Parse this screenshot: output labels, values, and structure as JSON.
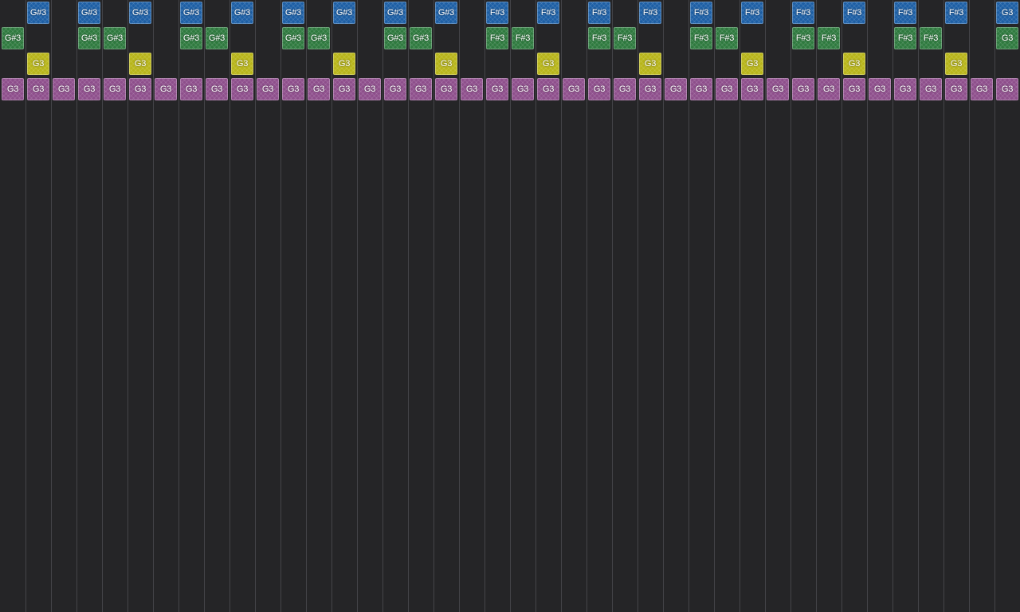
{
  "colors": {
    "background": "#252527",
    "grid_line": "#444448",
    "lanes": [
      "#1d5fa5",
      "#2f7a3f",
      "#b8b51a",
      "#8e4f8c"
    ]
  },
  "columns": 40,
  "lanes": [
    {
      "name": "lane-1",
      "notes": [
        "",
        "G#3",
        "",
        "G#3",
        "",
        "G#3",
        "",
        "G#3",
        "",
        "G#3",
        "",
        "G#3",
        "",
        "G#3",
        "",
        "G#3",
        "",
        "G#3",
        "",
        "F#3",
        "",
        "F#3",
        "",
        "F#3",
        "",
        "F#3",
        "",
        "F#3",
        "",
        "F#3",
        "",
        "F#3",
        "",
        "F#3",
        "",
        "F#3",
        "",
        "F#3",
        "",
        "G3"
      ]
    },
    {
      "name": "lane-2",
      "notes": [
        "G#3",
        "",
        "",
        "G#3",
        "G#3",
        "",
        "",
        "G#3",
        "G#3",
        "",
        "",
        "G#3",
        "G#3",
        "",
        "",
        "G#3",
        "G#3",
        "",
        "",
        "F#3",
        "F#3",
        "",
        "",
        "F#3",
        "F#3",
        "",
        "",
        "F#3",
        "F#3",
        "",
        "",
        "F#3",
        "F#3",
        "",
        "",
        "F#3",
        "F#3",
        "",
        "",
        "G3"
      ]
    },
    {
      "name": "lane-3",
      "notes": [
        "",
        "G3",
        "",
        "",
        "",
        "G3",
        "",
        "",
        "",
        "G3",
        "",
        "",
        "",
        "G3",
        "",
        "",
        "",
        "G3",
        "",
        "",
        "",
        "G3",
        "",
        "",
        "",
        "G3",
        "",
        "",
        "",
        "G3",
        "",
        "",
        "",
        "G3",
        "",
        "",
        "",
        "G3",
        "",
        ""
      ]
    },
    {
      "name": "lane-4",
      "notes": [
        "G3",
        "G3",
        "G3",
        "G3",
        "G3",
        "G3",
        "G3",
        "G3",
        "G3",
        "G3",
        "G3",
        "G3",
        "G3",
        "G3",
        "G3",
        "G3",
        "G3",
        "G3",
        "G3",
        "G3",
        "G3",
        "G3",
        "G3",
        "G3",
        "G3",
        "G3",
        "G3",
        "G3",
        "G3",
        "G3",
        "G3",
        "G3",
        "G3",
        "G3",
        "G3",
        "G3",
        "G3",
        "G3",
        "G3",
        "G3"
      ]
    }
  ]
}
